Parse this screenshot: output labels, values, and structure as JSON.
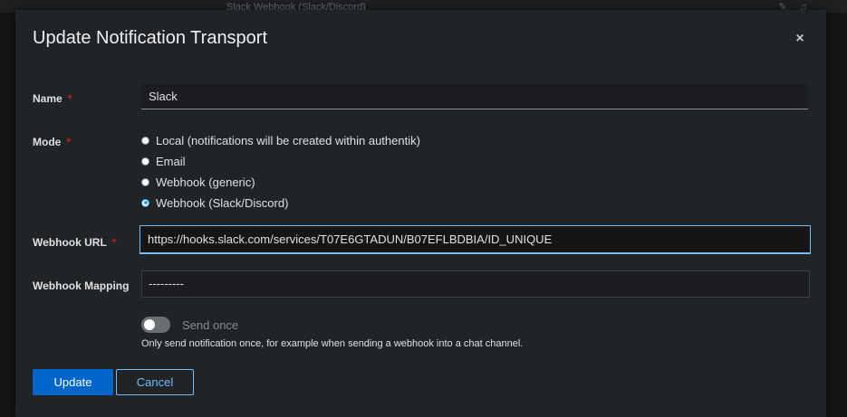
{
  "background": {
    "title": "Slack Webhook (Slack/Discord)"
  },
  "modal": {
    "title": "Update Notification Transport",
    "close_label": "×"
  },
  "form": {
    "name": {
      "label": "Name",
      "required": "*",
      "value": "Slack"
    },
    "mode": {
      "label": "Mode",
      "required": "*",
      "options": [
        {
          "label": "Local (notifications will be created within authentik)",
          "checked": false
        },
        {
          "label": "Email",
          "checked": false
        },
        {
          "label": "Webhook (generic)",
          "checked": false
        },
        {
          "label": "Webhook (Slack/Discord)",
          "checked": true
        }
      ]
    },
    "webhook_url": {
      "label": "Webhook URL",
      "required": "*",
      "value": "https://hooks.slack.com/services/T07E6GTADUN/B07EFLBDBIA/ID_UNIQUE"
    },
    "webhook_mapping": {
      "label": "Webhook Mapping",
      "value": "---------"
    },
    "send_once": {
      "label": "Send once",
      "enabled": false,
      "helper": "Only send notification once, for example when sending a webhook into a chat channel."
    }
  },
  "actions": {
    "update_label": "Update",
    "cancel_label": "Cancel"
  },
  "colors": {
    "primary": "#0066cc",
    "link": "#73bcf7",
    "required": "#c9190b"
  }
}
